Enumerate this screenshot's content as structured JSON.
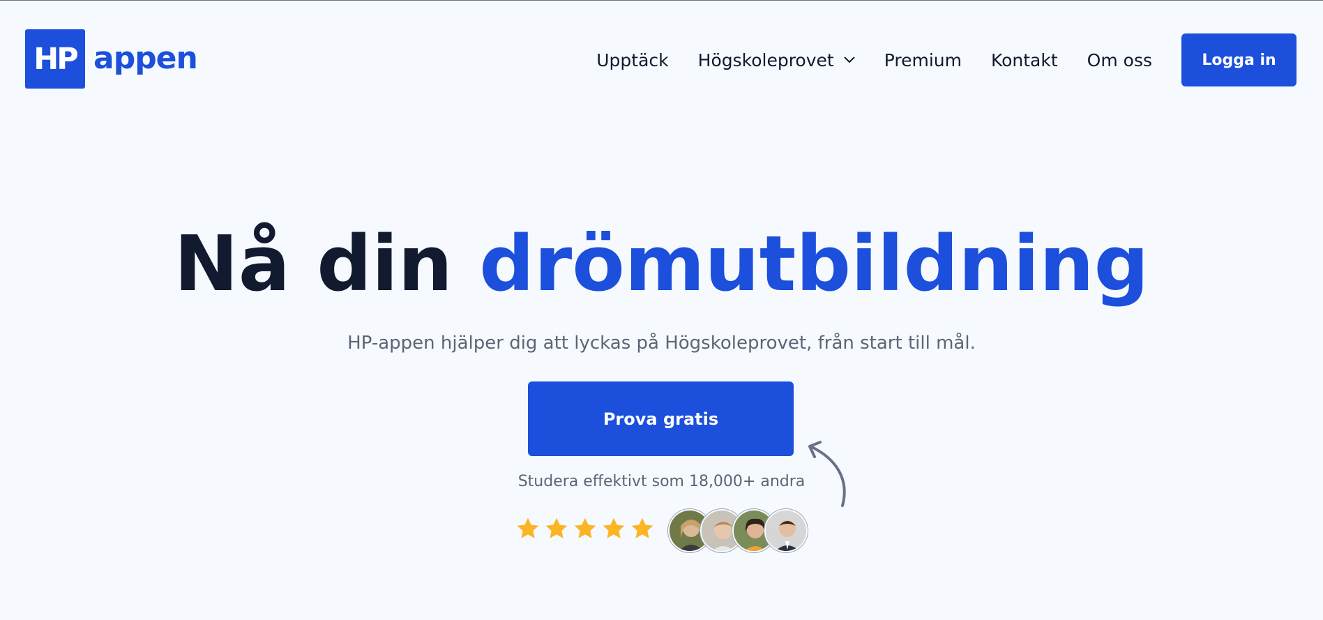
{
  "brand": {
    "logo_box": "HP",
    "logo_word": "appen",
    "color": "#1b4fdc"
  },
  "nav": {
    "items": [
      {
        "label": "Upptäck"
      },
      {
        "label": "Högskoleprovet",
        "has_dropdown": true
      },
      {
        "label": "Premium"
      },
      {
        "label": "Kontakt"
      },
      {
        "label": "Om oss"
      }
    ],
    "login_label": "Logga in"
  },
  "hero": {
    "title_dark": "Nå din",
    "title_accent": "drömutbildning",
    "subtitle": "HP-appen hjälper dig att lyckas på Högskoleprovet, från start till mål.",
    "cta_label": "Prova gratis",
    "social_proof": "Studera effektivt som 18,000+ andra",
    "rating": 5,
    "star_color": "#fbb424",
    "avatars": [
      {
        "icon": "avatar-photo-1",
        "bg": "#8a7a55"
      },
      {
        "icon": "avatar-photo-2",
        "bg": "#c9b8a4"
      },
      {
        "icon": "avatar-photo-3",
        "bg": "#6a7f4a"
      },
      {
        "icon": "avatar-photo-4",
        "bg": "#cfcfcf"
      }
    ]
  },
  "colors": {
    "background": "#f6f9fd",
    "text": "#111a2e",
    "muted": "#5b6576"
  }
}
